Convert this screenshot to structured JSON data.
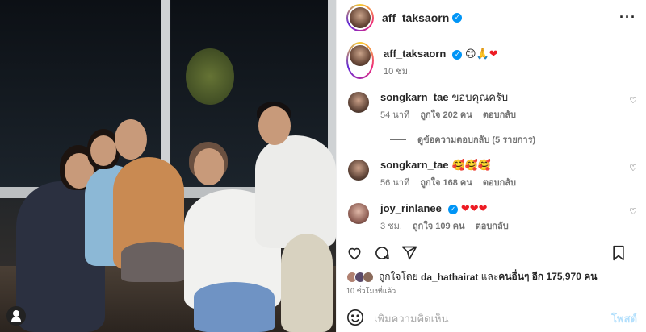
{
  "post": {
    "author": "aff_taksaorn",
    "caption_emojis": "😊🙏",
    "caption_heart": "❤",
    "caption_time": "10 ชม.",
    "more_label": "···"
  },
  "comments": [
    {
      "user": "songkarn_tae",
      "text": "ขอบคุณครับ",
      "time": "54 นาที",
      "likes": "ถูกใจ 202 คน",
      "reply": "ตอบกลับ"
    },
    {
      "user": "songkarn_tae",
      "text": "🥰🥰🥰",
      "time": "56 นาที",
      "likes": "ถูกใจ 168 คน",
      "reply": "ตอบกลับ"
    },
    {
      "user": "joy_rinlanee",
      "text": "❤❤❤",
      "time": "3 ชม.",
      "likes": "ถูกใจ 109 คน",
      "reply": "ตอบกลับ"
    }
  ],
  "view_replies": "ดูข้อความตอบกลับ (5 รายการ)",
  "likes": {
    "prefix": "ถูกใจโดย",
    "user": "da_hathairat",
    "middle": "และ",
    "others": "คนอื่นๆ อีก 175,970 คน"
  },
  "time_ago": "10 ชั่วโมงที่แล้ว",
  "add_comment": {
    "placeholder": "เพิ่มความคิดเห็น",
    "post_label": "โพสต์"
  },
  "icons": [
    "more-icon",
    "heart-icon",
    "comment-icon",
    "share-icon",
    "save-icon",
    "emoji-icon",
    "verified-icon",
    "user-tag-icon"
  ],
  "colors": {
    "link": "#0095f6",
    "muted": "#737373",
    "heart": "#ed1c24",
    "post_disabled": "#b2dffc"
  }
}
